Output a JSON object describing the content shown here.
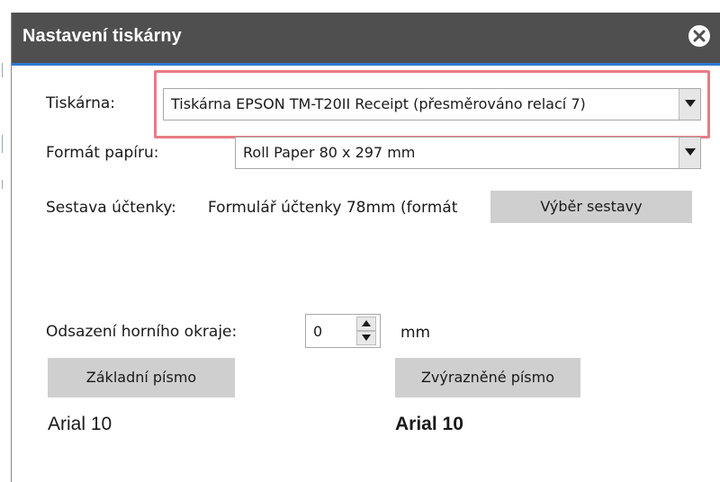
{
  "dialog": {
    "title": "Nastavení tiskárny"
  },
  "printer": {
    "label": "Tiskárna:",
    "value": "Tiskárna EPSON TM-T20II Receipt (přesměrováno relací 7)"
  },
  "paper": {
    "label": "Formát papíru:",
    "value": "Roll Paper 80 x 297 mm"
  },
  "report": {
    "label": "Sestava účtenky:",
    "value": "Formulář účtenky 78mm (formát",
    "select_button": "Výběr sestavy"
  },
  "top_offset": {
    "label": "Odsazení horního okraje:",
    "value": "0",
    "unit": "mm"
  },
  "fonts": {
    "basic_button": "Základní písmo",
    "basic_sample": "Arial 10",
    "bold_button": "Zvýrazněné písmo",
    "bold_sample": "Arial 10"
  },
  "colors": {
    "titlebar": "#4f4f4f",
    "title_accent": "#2c7ad1",
    "highlight": "#e87b85",
    "button": "#cfcfcf"
  },
  "icons": {
    "close": "close-icon",
    "dropdown": "chevron-down-icon",
    "spin_up": "arrow-up-icon",
    "spin_down": "arrow-down-icon"
  }
}
